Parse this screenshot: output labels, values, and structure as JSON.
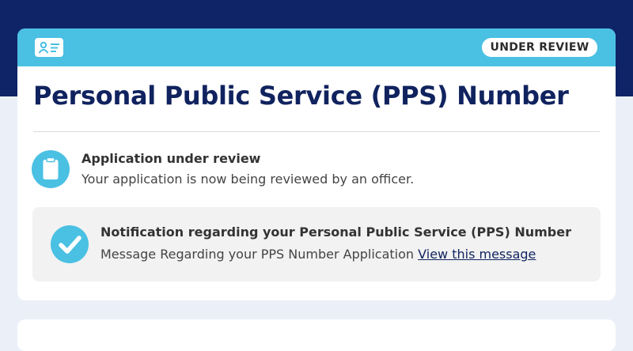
{
  "colors": {
    "navy": "#0f2466",
    "accent": "#4ac0e3",
    "page_bg": "#ebeff8",
    "title": "#10235f"
  },
  "card": {
    "header_icon": "id-card-icon",
    "status_badge": "UNDER REVIEW",
    "title": "Personal Public Service (PPS) Number"
  },
  "review": {
    "icon": "clipboard-icon",
    "title": "Application under review",
    "description": "Your application is now being reviewed by an officer."
  },
  "notification": {
    "icon": "check-circle-icon",
    "title": "Notification regarding your Personal Public Service (PPS) Number",
    "message": "Message Regarding your PPS Number Application",
    "link_label": "View this message"
  }
}
